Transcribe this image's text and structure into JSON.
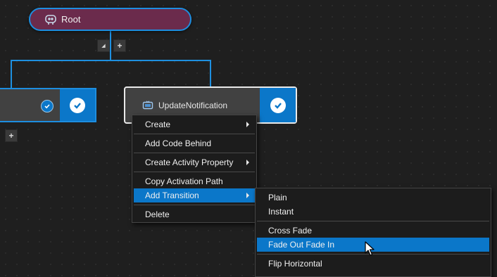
{
  "root_node": {
    "label": "Root",
    "icon": "robot-icon"
  },
  "mini_buttons": {
    "collapse": "◢",
    "add": "+"
  },
  "left_node": {
    "add_below": "+"
  },
  "selected_node": {
    "label": "UpdateNotification",
    "icon": "monitor-icon"
  },
  "context_menu": {
    "items": [
      {
        "label": "Create",
        "has_submenu": true
      },
      {
        "label": "Add Code Behind",
        "has_submenu": false
      },
      {
        "label": "Create Activity Property",
        "has_submenu": true
      },
      {
        "label": "Copy Activation Path",
        "has_submenu": false
      },
      {
        "label": "Add Transition",
        "has_submenu": true,
        "highlighted": true
      },
      {
        "label": "Delete",
        "has_submenu": false
      }
    ]
  },
  "submenu": {
    "items": [
      {
        "label": "Plain"
      },
      {
        "label": "Instant"
      },
      {
        "label": "Cross Fade"
      },
      {
        "label": "Fade Out Fade In",
        "highlighted": true
      },
      {
        "label": "Flip Horizontal"
      }
    ]
  },
  "colors": {
    "accent": "#0b77c9",
    "wire": "#1e90e0",
    "root_fill": "#6b2b4c",
    "node_fill": "#414141"
  }
}
